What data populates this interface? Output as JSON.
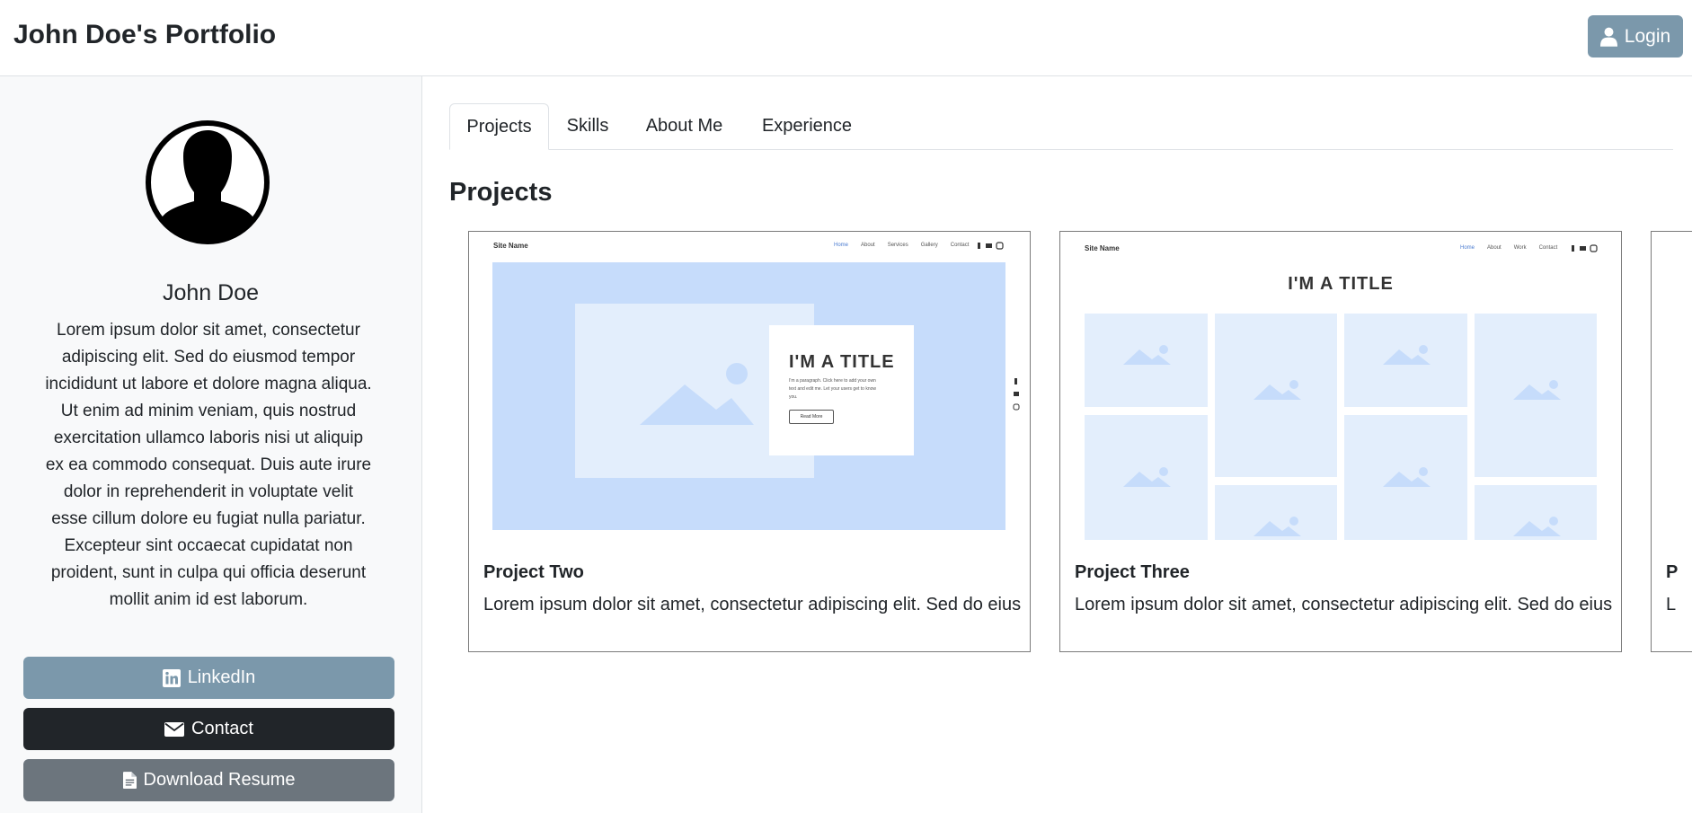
{
  "header": {
    "brand": "John Doe's Portfolio",
    "login_label": "Login"
  },
  "profile": {
    "name": "John Doe",
    "bio": "Lorem ipsum dolor sit amet, consectetur adipiscing elit. Sed do eiusmod tempor incididunt ut labore et dolore magna aliqua. Ut enim ad minim veniam, quis nostrud exercitation ullamco laboris nisi ut aliquip ex ea commodo consequat. Duis aute irure dolor in reprehenderit in voluptate velit esse cillum dolore eu fugiat nulla pariatur. Excepteur sint occaecat cupidatat non proident, sunt in culpa qui officia deserunt mollit anim id est laborum.",
    "buttons": {
      "linkedin": "LinkedIn",
      "contact": "Contact",
      "resume": "Download Resume"
    }
  },
  "tabs": [
    {
      "label": "Projects",
      "active": true
    },
    {
      "label": "Skills",
      "active": false
    },
    {
      "label": "About Me",
      "active": false
    },
    {
      "label": "Experience",
      "active": false
    }
  ],
  "section_title": "Projects",
  "projects": [
    {
      "title": "Project Two",
      "description": "Lorem ipsum dolor sit amet, consectetur adipiscing elit. Sed do eius",
      "preview": {
        "site_name": "Site Name",
        "nav": [
          "Home",
          "About",
          "Services",
          "Gallery",
          "Contact"
        ],
        "hero_title": "I'M A TITLE",
        "hero_text": "I'm a paragraph. Click here to add your own text and edit me. Let your users get to know you.",
        "hero_button": "Read More"
      }
    },
    {
      "title": "Project Three",
      "description": "Lorem ipsum dolor sit amet, consectetur adipiscing elit. Sed do eius",
      "preview": {
        "site_name": "Site Name",
        "nav": [
          "Home",
          "About",
          "Work",
          "Contact"
        ],
        "hero_title": "I'M A TITLE"
      }
    },
    {
      "title": "P",
      "description": "L"
    }
  ],
  "colors": {
    "accent": "#7b98ab",
    "dark": "#212529",
    "secondary": "#6c757d",
    "placeholder_light": "#e3eefc",
    "placeholder_mid": "#c6dcfb"
  },
  "icons": {
    "login": "person-icon",
    "linkedin": "linkedin-icon",
    "contact": "envelope-icon",
    "resume": "file-icon"
  }
}
